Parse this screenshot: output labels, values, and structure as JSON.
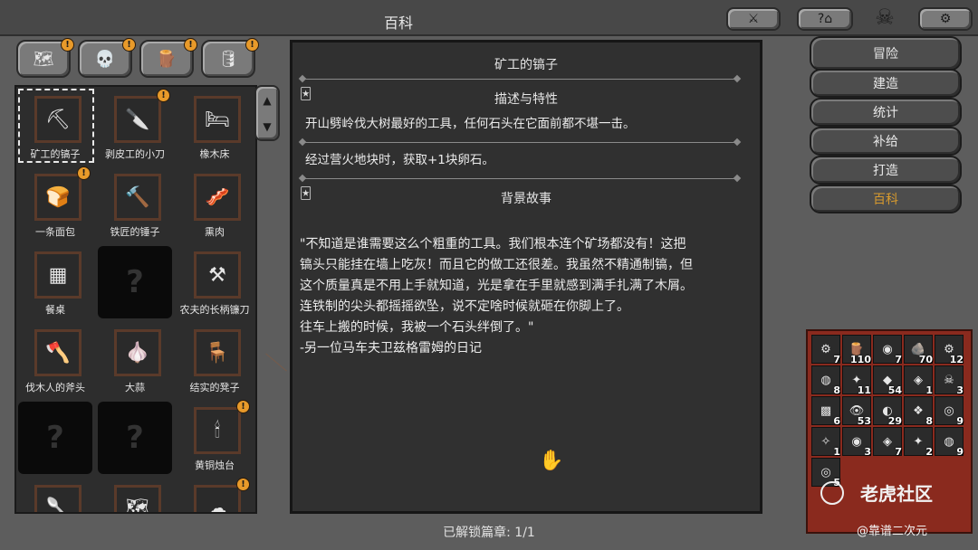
{
  "window": {
    "title": "百科"
  },
  "top_icons": {
    "combat": "swords-icon",
    "help": "help-icon",
    "settings": "gear-icon",
    "skull": "skull-icon"
  },
  "category_tabs": [
    {
      "icon": "map-icon",
      "badge": "!"
    },
    {
      "icon": "skull-helmet-icon",
      "badge": "!"
    },
    {
      "icon": "resource-icon",
      "badge": "!"
    },
    {
      "icon": "barrel-icon",
      "badge": "!"
    }
  ],
  "items": [
    {
      "label": "矿工的镐子",
      "icon": "⛏",
      "selected": true
    },
    {
      "label": "剥皮工的小刀",
      "icon": "🔪",
      "badge": "!"
    },
    {
      "label": "橡木床",
      "icon": "🛏"
    },
    {
      "label": "一条面包",
      "icon": "🍞",
      "badge": "!"
    },
    {
      "label": "铁匠的锤子",
      "icon": "🔨"
    },
    {
      "label": "熏肉",
      "icon": "🥓"
    },
    {
      "label": "餐桌",
      "icon": "▦"
    },
    {
      "label": "",
      "locked": true
    },
    {
      "label": "农夫的长柄镰刀",
      "icon": "⚒"
    },
    {
      "label": "伐木人的斧头",
      "icon": "🪓"
    },
    {
      "label": "大蒜",
      "icon": "🧄"
    },
    {
      "label": "结实的凳子",
      "icon": "🪑"
    },
    {
      "label": "",
      "locked": true
    },
    {
      "label": "",
      "locked": true
    },
    {
      "label": "黄铜烛台",
      "icon": "🕯",
      "badge": "!"
    },
    {
      "label": "",
      "icon": "🥄"
    },
    {
      "label": "",
      "icon": "🗺"
    },
    {
      "label": "",
      "icon": "☁",
      "badge": "!"
    }
  ],
  "detail": {
    "title": "矿工的镐子",
    "section1": {
      "heading": "描述与特性",
      "icon": "🃏"
    },
    "desc1": "开山劈岭伐大树最好的工具，任何石头在它面前都不堪一击。",
    "desc2": "经过营火地块时，获取+1块卵石。",
    "section2": {
      "heading": "背景故事",
      "icon": "🃏"
    },
    "story": "\"不知道是谁需要这么个粗重的工具。我们根本连个矿场都没有！这把\n镐头只能挂在墙上吃灰！而且它的做工还很差。我虽然不精通制镐，但\n这个质量真是不用上手就知道，光是拿在手里就感到满手扎满了木屑。\n连铁制的尖头都摇摇欲坠，说不定啥时候就砸在你脚上了。\n  往车上搬的时候，我被一个石头绊倒了。\"\n  -另一位马车夫卫兹格雷姆的日记"
  },
  "footer": {
    "unlocked": "已解锁篇章: 1/1"
  },
  "menu": [
    {
      "label": "冒险",
      "active": false
    },
    {
      "label": "建造",
      "active": false
    },
    {
      "label": "统计",
      "active": false
    },
    {
      "label": "补给",
      "active": false
    },
    {
      "label": "打造",
      "active": false
    },
    {
      "label": "百科",
      "active": true
    }
  ],
  "inventory": [
    {
      "icon": "⚙",
      "count": "7"
    },
    {
      "icon": "🪵",
      "count": "110"
    },
    {
      "icon": "◉",
      "count": "7"
    },
    {
      "icon": "🪨",
      "count": "70"
    },
    {
      "icon": "⚙",
      "count": "12"
    },
    {
      "icon": "◍",
      "count": "8"
    },
    {
      "icon": "✦",
      "count": "11"
    },
    {
      "icon": "◆",
      "count": "54"
    },
    {
      "icon": "◈",
      "count": "1"
    },
    {
      "icon": "☠",
      "count": "3"
    },
    {
      "icon": "▩",
      "count": "6"
    },
    {
      "icon": "👁",
      "count": "53"
    },
    {
      "icon": "◐",
      "count": "29"
    },
    {
      "icon": "❖",
      "count": "8"
    },
    {
      "icon": "◎",
      "count": "9"
    },
    {
      "icon": "✧",
      "count": "1"
    },
    {
      "icon": "◉",
      "count": "3"
    },
    {
      "icon": "◈",
      "count": "7"
    },
    {
      "icon": "✦",
      "count": "2"
    },
    {
      "icon": "◍",
      "count": "9"
    },
    {
      "icon": "◎",
      "count": "5"
    }
  ],
  "watermark": {
    "main": "老虎社区",
    "sub": "@靠谱二次元"
  },
  "colors": {
    "accent": "#d79a2e",
    "badge": "#e89a2a",
    "inventory_bg": "#8a2a1e"
  }
}
